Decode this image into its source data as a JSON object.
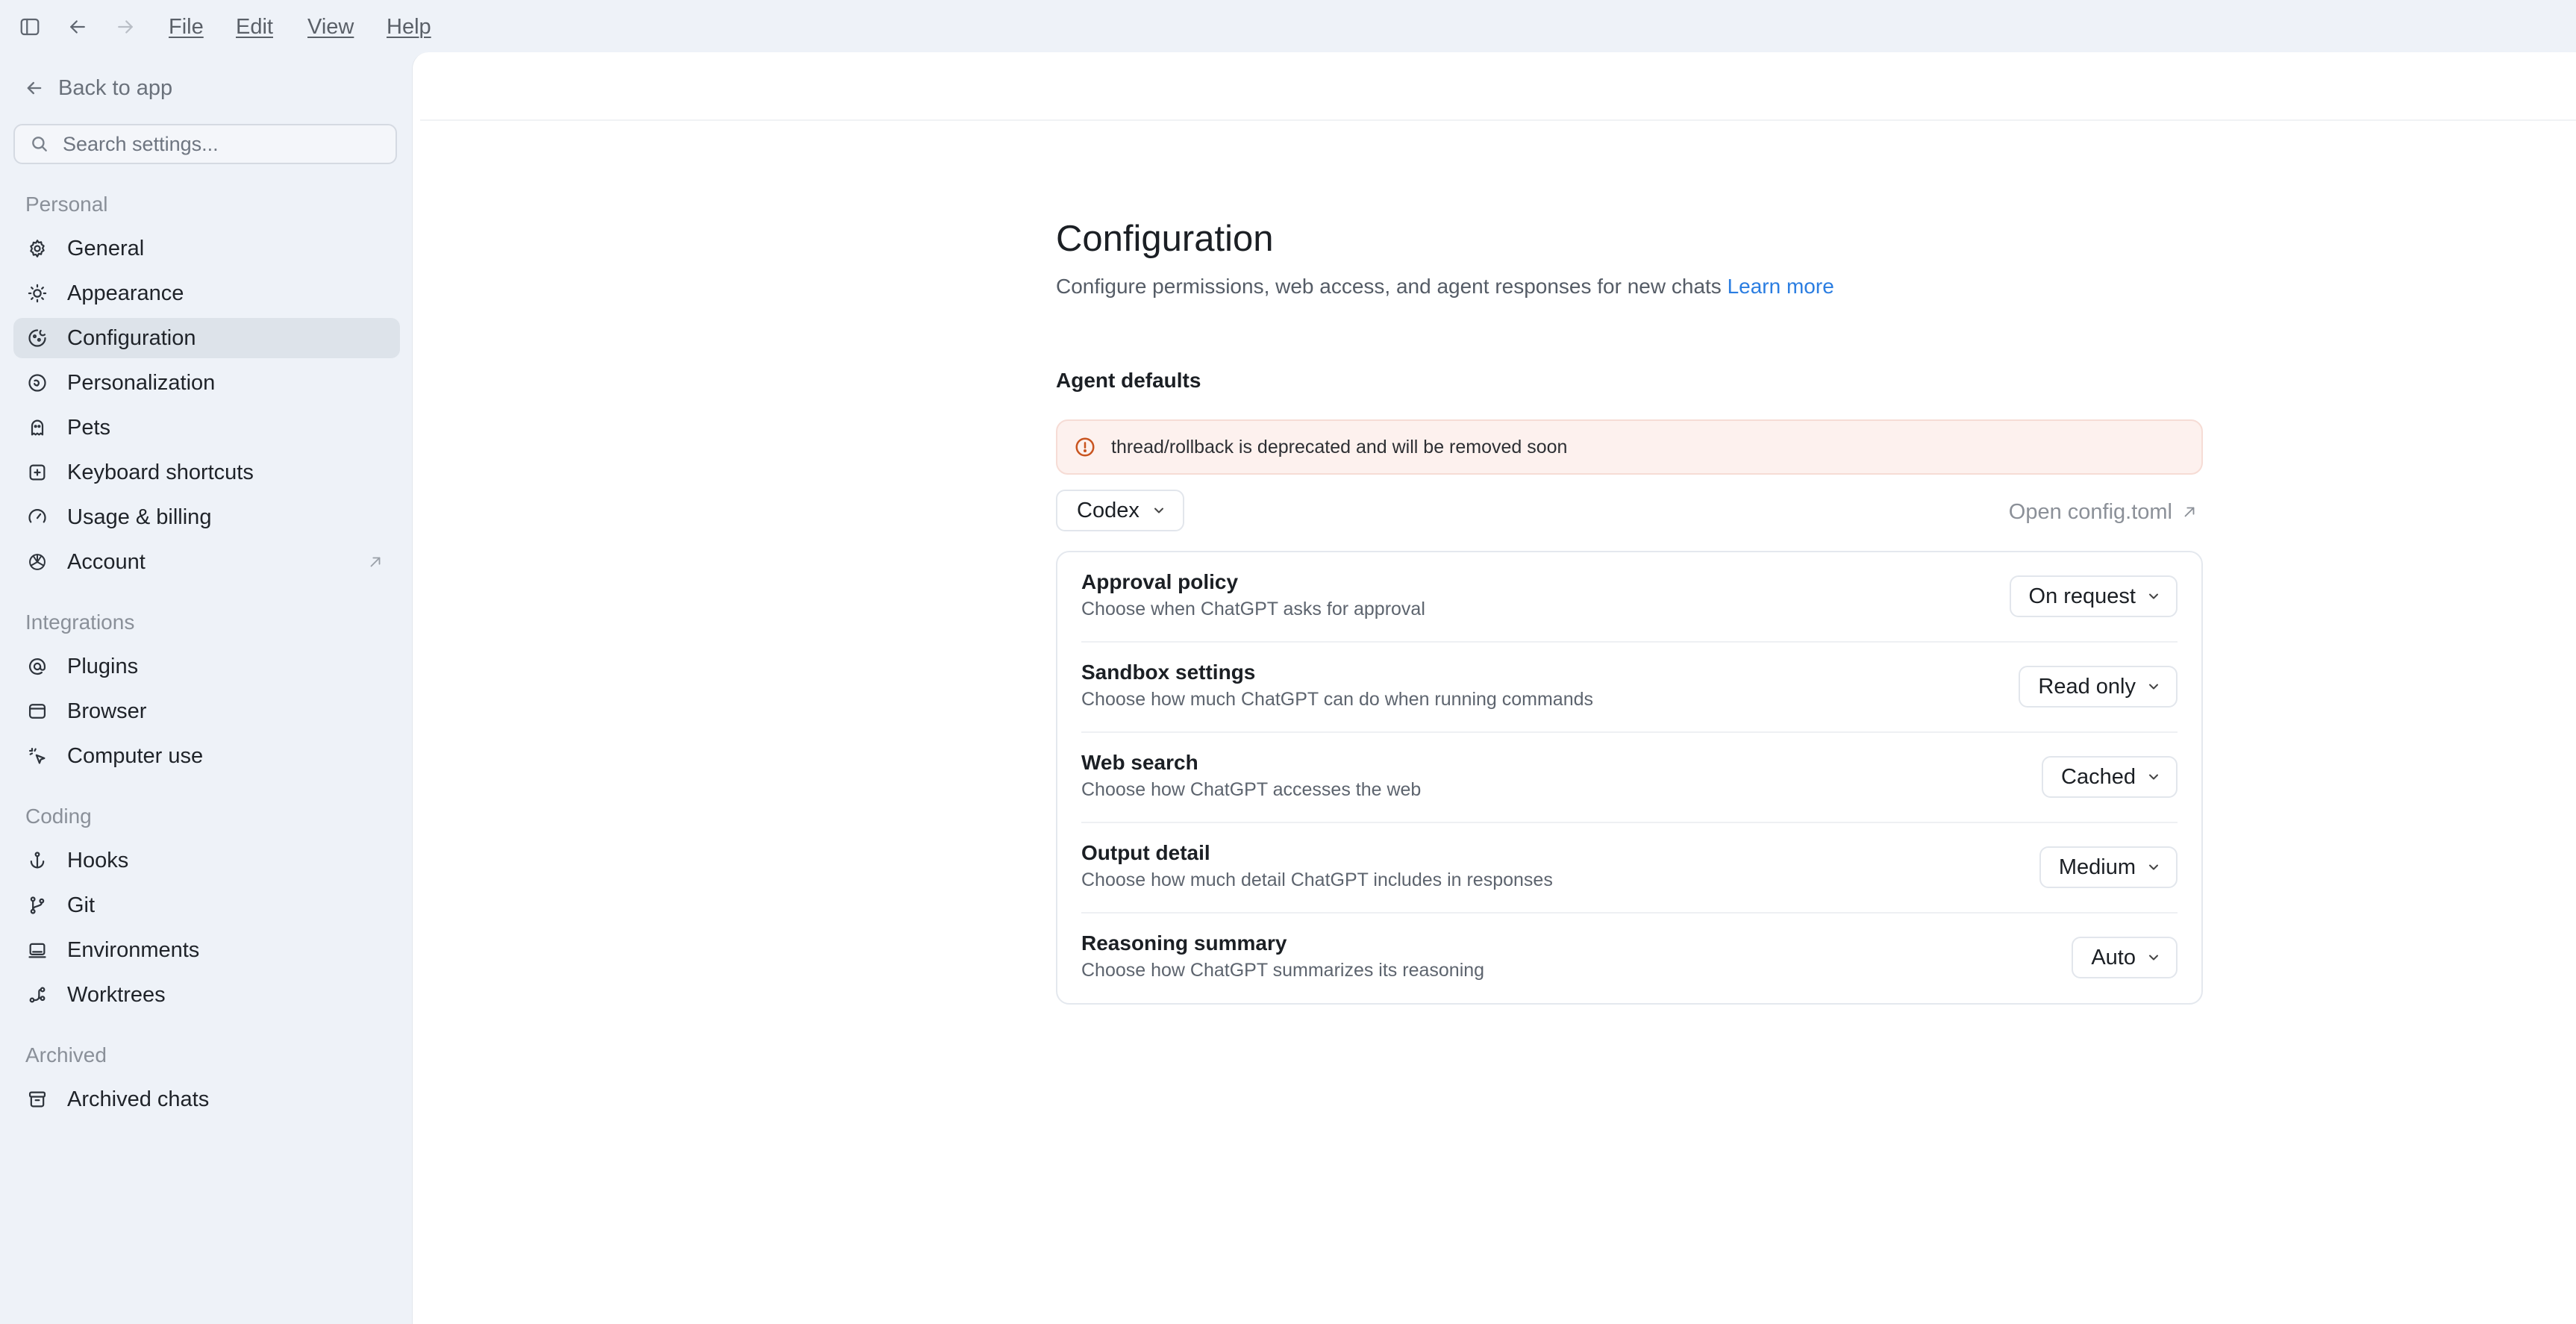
{
  "menubar": {
    "file": "File",
    "edit": "Edit",
    "view": "View",
    "help": "Help"
  },
  "sidebar": {
    "back_label": "Back to app",
    "search_placeholder": "Search settings...",
    "sections": [
      {
        "title": "Personal",
        "items": [
          {
            "label": "General",
            "icon": "gear-icon"
          },
          {
            "label": "Appearance",
            "icon": "sun-icon"
          },
          {
            "label": "Configuration",
            "icon": "config-icon",
            "active": true
          },
          {
            "label": "Personalization",
            "icon": "personalization-icon"
          },
          {
            "label": "Pets",
            "icon": "pet-icon"
          },
          {
            "label": "Keyboard shortcuts",
            "icon": "keyboard-icon"
          },
          {
            "label": "Usage & billing",
            "icon": "gauge-icon"
          },
          {
            "label": "Account",
            "icon": "openai-icon",
            "external": true
          }
        ]
      },
      {
        "title": "Integrations",
        "items": [
          {
            "label": "Plugins",
            "icon": "plugin-icon"
          },
          {
            "label": "Browser",
            "icon": "browser-icon"
          },
          {
            "label": "Computer use",
            "icon": "cursor-icon"
          }
        ]
      },
      {
        "title": "Coding",
        "items": [
          {
            "label": "Hooks",
            "icon": "anchor-icon"
          },
          {
            "label": "Git",
            "icon": "git-branch-icon"
          },
          {
            "label": "Environments",
            "icon": "laptop-icon"
          },
          {
            "label": "Worktrees",
            "icon": "worktree-icon"
          }
        ]
      },
      {
        "title": "Archived",
        "items": [
          {
            "label": "Archived chats",
            "icon": "archive-icon"
          }
        ]
      }
    ]
  },
  "page": {
    "title": "Configuration",
    "subtitle": "Configure permissions, web access, and agent responses for new chats",
    "learn_more": "Learn more",
    "group_title": "Agent defaults",
    "alert_text": "thread/rollback is deprecated and will be removed soon",
    "profile_select": "Codex",
    "open_config": "Open config.toml",
    "settings": [
      {
        "title": "Approval policy",
        "description": "Choose when ChatGPT asks for approval",
        "value": "On request"
      },
      {
        "title": "Sandbox settings",
        "description": "Choose how much ChatGPT can do when running commands",
        "value": "Read only"
      },
      {
        "title": "Web search",
        "description": "Choose how ChatGPT accesses the web",
        "value": "Cached"
      },
      {
        "title": "Output detail",
        "description": "Choose how much detail ChatGPT includes in responses",
        "value": "Medium"
      },
      {
        "title": "Reasoning summary",
        "description": "Choose how ChatGPT summarizes its reasoning",
        "value": "Auto"
      }
    ]
  },
  "colors": {
    "accent_link": "#2a7de1",
    "alert_bg": "#fdf1ee",
    "alert_icon": "#c9541f",
    "active_item": "#dde3ea"
  }
}
